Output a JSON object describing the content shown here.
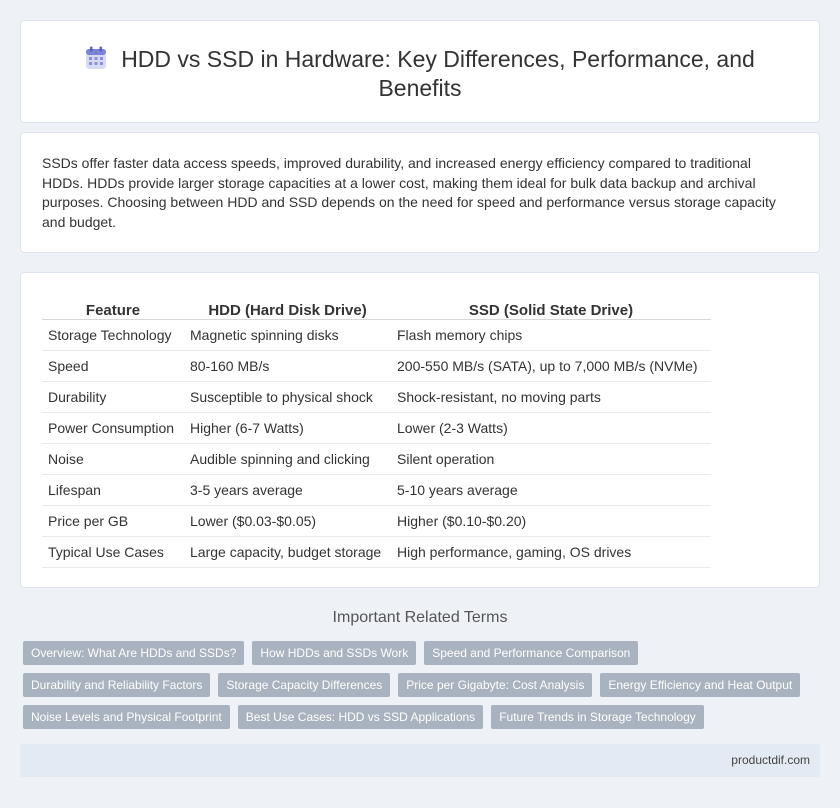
{
  "header": {
    "title": "HDD vs SSD in Hardware: Key Differences, Performance, and Benefits",
    "icon": "calendar-icon"
  },
  "intro": {
    "text": "SSDs offer faster data access speeds, improved durability, and increased energy efficiency compared to traditional HDDs. HDDs provide larger storage capacities at a lower cost, making them ideal for bulk data backup and archival purposes. Choosing between HDD and SSD depends on the need for speed and performance versus storage capacity and budget."
  },
  "table": {
    "headers": [
      "Feature",
      "HDD (Hard Disk Drive)",
      "SSD (Solid State Drive)"
    ],
    "rows": [
      [
        "Storage Technology",
        "Magnetic spinning disks",
        "Flash memory chips"
      ],
      [
        "Speed",
        "80-160 MB/s",
        "200-550 MB/s (SATA), up to 7,000 MB/s (NVMe)"
      ],
      [
        "Durability",
        "Susceptible to physical shock",
        "Shock-resistant, no moving parts"
      ],
      [
        "Power Consumption",
        "Higher (6-7 Watts)",
        "Lower (2-3 Watts)"
      ],
      [
        "Noise",
        "Audible spinning and clicking",
        "Silent operation"
      ],
      [
        "Lifespan",
        "3-5 years average",
        "5-10 years average"
      ],
      [
        "Price per GB",
        "Lower ($0.03-$0.05)",
        "Higher ($0.10-$0.20)"
      ],
      [
        "Typical Use Cases",
        "Large capacity, budget storage",
        "High performance, gaming, OS drives"
      ]
    ]
  },
  "related": {
    "title": "Important Related Terms",
    "tags": [
      "Overview: What Are HDDs and SSDs?",
      "How HDDs and SSDs Work",
      "Speed and Performance Comparison",
      "Durability and Reliability Factors",
      "Storage Capacity Differences",
      "Price per Gigabyte: Cost Analysis",
      "Energy Efficiency and Heat Output",
      "Noise Levels and Physical Footprint",
      "Best Use Cases: HDD vs SSD Applications",
      "Future Trends in Storage Technology"
    ]
  },
  "footer": {
    "text": "productdif.com"
  },
  "colors": {
    "background": "#eef2f7",
    "tag": "#a9b3bf",
    "footer": "#e4eaf3",
    "icon_header": "#7b83d6",
    "icon_body": "#c9cdf0"
  }
}
